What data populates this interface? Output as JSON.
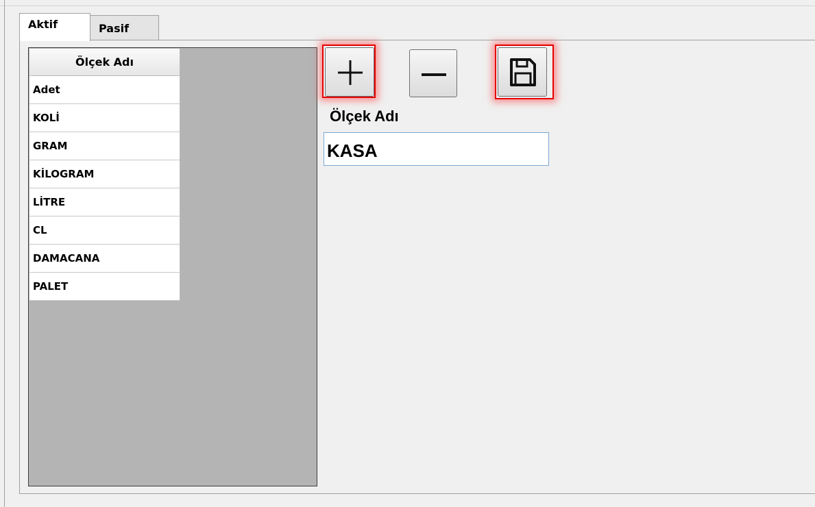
{
  "tabs": [
    {
      "label": "Aktif",
      "active": true
    },
    {
      "label": "Pasif",
      "active": false
    }
  ],
  "grid": {
    "header": "Ölçek Adı",
    "rows": [
      "Adet",
      "KOLİ",
      "GRAM",
      "KİLOGRAM",
      "LİTRE",
      "CL",
      "DAMACANA",
      "PALET"
    ]
  },
  "toolbar": {
    "add_icon": "plus-icon",
    "remove_icon": "minus-icon",
    "save_icon": "floppy-disk-icon",
    "highlight_color": "#e60000"
  },
  "form": {
    "label": "Ölçek Adı",
    "value": "KASA"
  }
}
